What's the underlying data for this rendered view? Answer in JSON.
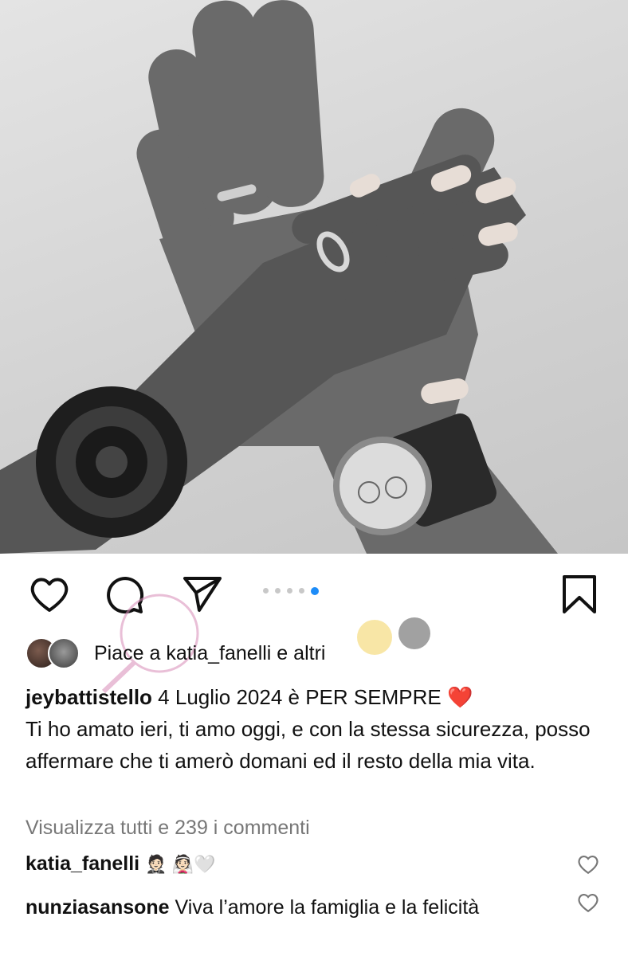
{
  "post": {
    "image_alt": "hands with wedding rings",
    "carousel": {
      "count": 5,
      "active": 5
    }
  },
  "actions": {
    "like_icon": "heart-outline-icon",
    "comment_icon": "comment-bubble-icon",
    "share_icon": "paper-plane-icon",
    "save_icon": "bookmark-icon"
  },
  "likes": {
    "text": "Piace a katia_fanelli e altri"
  },
  "caption": {
    "username": "jeybattistello",
    "text": "4 Luglio 2024 è PER SEMPRE",
    "emoji": "❤️",
    "body": "Ti ho amato ieri, ti amo oggi, e con la stessa sicurezza, posso affermare che ti amerò domani ed il resto della mia vita."
  },
  "view_all": "Visualizza tutti e 239 i commenti",
  "comments": [
    {
      "username": "katia_fanelli",
      "text": "🤵🏻 👰🏻🤍"
    },
    {
      "username": "nunziasansone",
      "text": "Viva l’amore la famiglia e la felicità"
    }
  ],
  "colors": {
    "accent": "#1d8cf8",
    "heart": "#e0212d",
    "muted": "#777777"
  }
}
